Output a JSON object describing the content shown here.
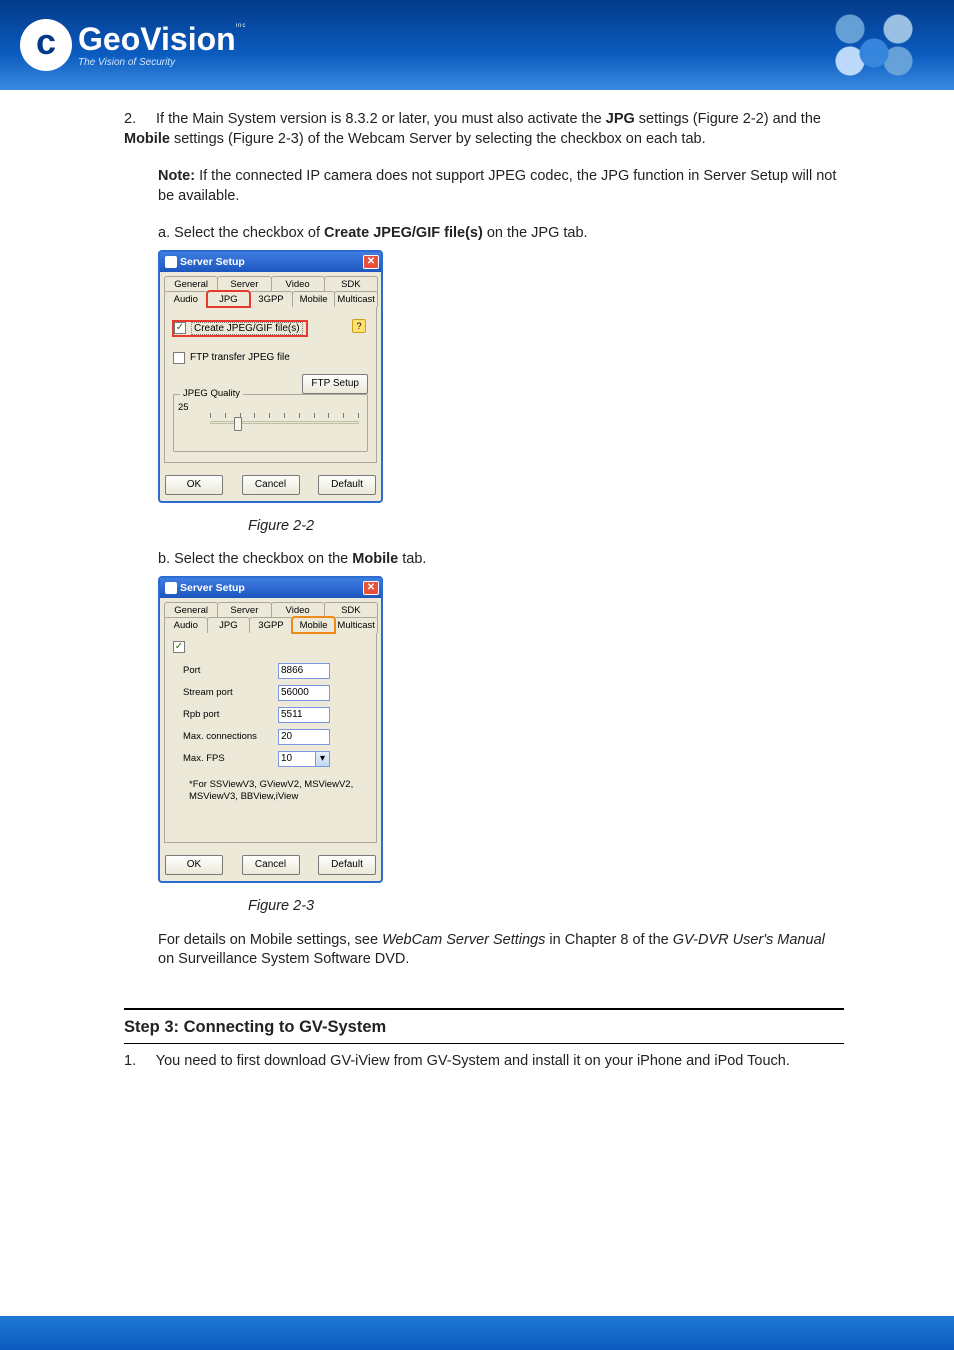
{
  "header": {
    "brand_geo": "Geo",
    "brand_vision": "Vision",
    "brand_suffix": "inc",
    "tagline": "The Vision of Security"
  },
  "intro1": {
    "num": "2.",
    "text_a": "If the Main System version is 8.3.2 or later, you must also activate the ",
    "text_b": "JPG",
    "text_c": " settings (Figure 2-2) and the ",
    "text_d": "Mobile",
    "text_e": " settings (Figure 2-3) of the Webcam Server by selecting the checkbox on each tab."
  },
  "note": {
    "label": "Note:",
    "text": " If the connected IP camera does not support JPEG codec, the JPG function in Server Setup will not be available."
  },
  "dialog_common": {
    "title": "Server Setup",
    "tabs_back": [
      "General",
      "Server",
      "Video",
      "SDK"
    ],
    "tabs_front": [
      "Audio",
      "JPG",
      "3GPP",
      "Mobile",
      "Multicast"
    ],
    "buttons": {
      "ok": "OK",
      "cancel": "Cancel",
      "default": "Default"
    }
  },
  "d1": {
    "chk_create_label": "Create JPEG/GIF file(s)",
    "chk_ftp_label": "FTP transfer JPEG file",
    "ftp_setup": "FTP Setup",
    "group_title": "JPEG Quality",
    "quality_value": "25"
  },
  "sub_a": {
    "bullet": "a.",
    "text_a": "Select the checkbox of ",
    "text_b": "Create JPEG/GIF file(s)",
    "text_c": " on the JPG tab."
  },
  "fig22": "Figure 2-2",
  "sub_b": {
    "bullet": "b.",
    "text_a": "Select the checkbox on the ",
    "text_b": "Mobile",
    "text_c": " tab."
  },
  "d2": {
    "port_label": "Port",
    "port_value": "8866",
    "stream_label": "Stream port",
    "stream_value": "56000",
    "rpb_label": "Rpb port",
    "rpb_value": "5511",
    "max_conn_label": "Max. connections",
    "max_conn_value": "20",
    "max_fps_label": "Max. FPS",
    "max_fps_value": "10",
    "note_text": "*For SSViewV3, GViewV2, MSViewV2, MSViewV3, BBView,iView"
  },
  "fig23": "Figure 2-3",
  "para_post": {
    "text_a": "For details on Mobile settings, see ",
    "text_i": "WebCam Server Settings",
    "text_b": " in Chapter 8 of the ",
    "text_i2": "GV-DVR User's Manual",
    "text_c": " on Surveillance System Software DVD."
  },
  "step3": {
    "heading": "Step 3: Connecting to GV-System",
    "num": "1.",
    "body": "You need to first download GV-iView from GV-System and install it on your iPhone and iPod Touch."
  }
}
